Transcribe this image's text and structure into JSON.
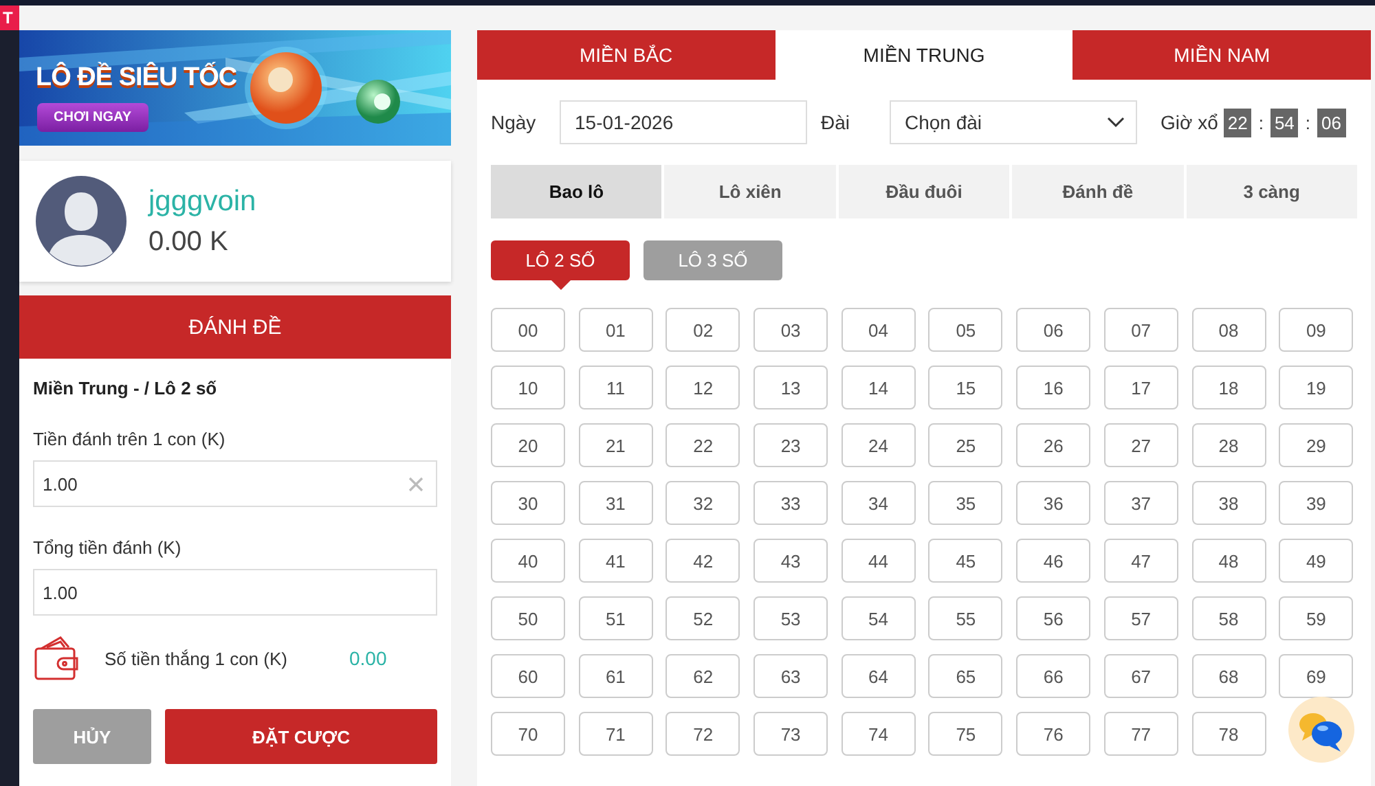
{
  "edge_badge": "T",
  "banner": {
    "title": "LÔ ĐỀ SIÊU TỐC",
    "button": "CHƠI NGAY"
  },
  "profile": {
    "username": "jgggvoin",
    "balance": "0.00 K"
  },
  "bet_panel": {
    "title": "ĐÁNH ĐỀ",
    "subtitle": "Miền Trung - / Lô 2 số",
    "fields": [
      {
        "label": "Tiền đánh trên 1 con (K)",
        "value": "1.00",
        "clearable": true
      },
      {
        "label": "Tổng tiền đánh (K)",
        "value": "1.00",
        "clearable": false
      }
    ],
    "win_label": "Số tiền thắng 1 con (K)",
    "win_value": "0.00",
    "buttons": [
      {
        "kind": "cancel",
        "label": "HỦY"
      },
      {
        "kind": "submit",
        "label": "ĐẶT CƯỢC"
      }
    ]
  },
  "region_tabs": [
    {
      "label": "MIỀN BẮC",
      "selected": false
    },
    {
      "label": "MIỀN TRUNG",
      "selected": true
    },
    {
      "label": "MIỀN NAM",
      "selected": false
    }
  ],
  "filters": {
    "date_label": "Ngày",
    "date_value": "15-01-2026",
    "station_label": "Đài",
    "station_value": "Chọn đài",
    "time_label": "Giờ xổ",
    "time_parts": [
      "22",
      "54",
      "06"
    ],
    "separator": ":"
  },
  "bet_types": [
    {
      "label": "Bao lô",
      "selected": true
    },
    {
      "label": "Lô xiên",
      "selected": false
    },
    {
      "label": "Đầu đuôi",
      "selected": false
    },
    {
      "label": "Đánh đề",
      "selected": false
    },
    {
      "label": "3 càng",
      "selected": false
    }
  ],
  "lo_modes": [
    {
      "label": "LÔ 2 SỐ",
      "selected": true
    },
    {
      "label": "LÔ 3 SỐ",
      "selected": false
    }
  ],
  "numbers": [
    [
      "00",
      "01",
      "02",
      "03",
      "04",
      "05",
      "06",
      "07",
      "08",
      "09"
    ],
    [
      "10",
      "11",
      "12",
      "13",
      "14",
      "15",
      "16",
      "17",
      "18",
      "19"
    ],
    [
      "20",
      "21",
      "22",
      "23",
      "24",
      "25",
      "26",
      "27",
      "28",
      "29"
    ],
    [
      "30",
      "31",
      "32",
      "33",
      "34",
      "35",
      "36",
      "37",
      "38",
      "39"
    ],
    [
      "40",
      "41",
      "42",
      "43",
      "44",
      "45",
      "46",
      "47",
      "48",
      "49"
    ],
    [
      "50",
      "51",
      "52",
      "53",
      "54",
      "55",
      "56",
      "57",
      "58",
      "59"
    ],
    [
      "60",
      "61",
      "62",
      "63",
      "64",
      "65",
      "66",
      "67",
      "68",
      "69"
    ],
    [
      "70",
      "71",
      "72",
      "73",
      "74",
      "75",
      "76",
      "77",
      "78"
    ]
  ]
}
